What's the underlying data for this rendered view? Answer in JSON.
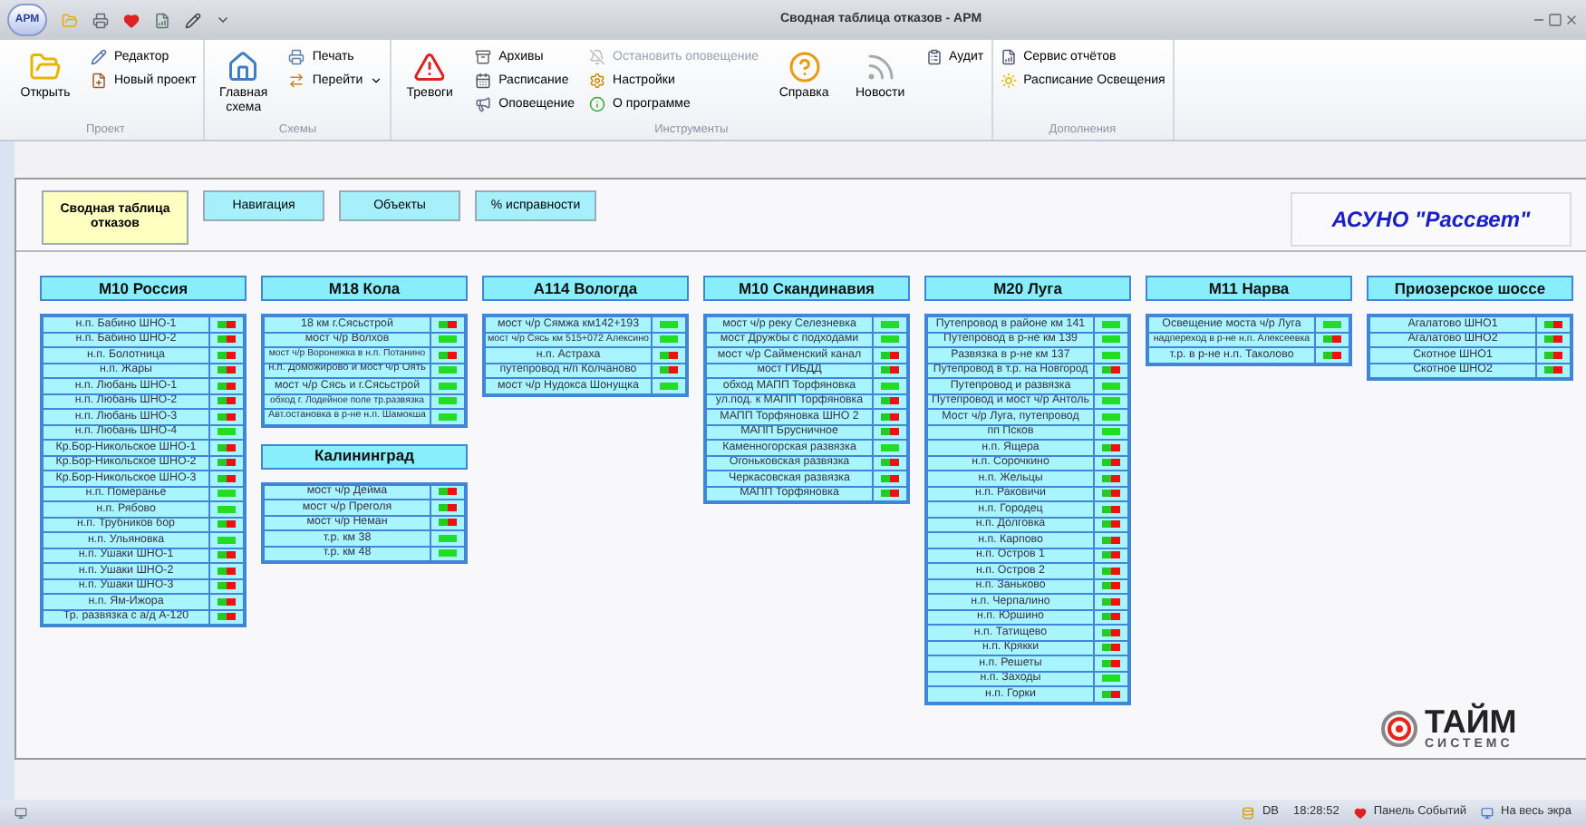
{
  "window": {
    "logo": "АРМ",
    "title": "Сводная таблица отказов - АРМ"
  },
  "ribbon": [
    {
      "label": "Проект",
      "items": [
        {
          "label": "Открыть",
          "kind": "large",
          "disabled": false
        },
        {
          "label": "Редактор",
          "kind": "small",
          "disabled": false
        },
        {
          "label": "Новый проект",
          "kind": "small",
          "disabled": false
        }
      ]
    },
    {
      "label": "Схемы",
      "items": [
        {
          "label": "Главная схема",
          "kind": "large",
          "disabled": false
        },
        {
          "label": "Печать",
          "kind": "small",
          "disabled": false
        },
        {
          "label": "Перейти",
          "kind": "small",
          "disabled": false,
          "caret": true
        }
      ]
    },
    {
      "label": "Инструменты",
      "items": [
        {
          "label": "Тревоги",
          "kind": "large",
          "disabled": false
        },
        {
          "label": "Архивы",
          "kind": "small",
          "disabled": false
        },
        {
          "label": "Расписание",
          "kind": "small",
          "disabled": false
        },
        {
          "label": "Оповещение",
          "kind": "small",
          "disabled": false
        },
        {
          "label": "Остановить оповещение",
          "kind": "small",
          "disabled": true
        },
        {
          "label": "Настройки",
          "kind": "small",
          "disabled": false
        },
        {
          "label": "О программе",
          "kind": "small",
          "disabled": false
        },
        {
          "label": "Справка",
          "kind": "large",
          "disabled": false
        },
        {
          "label": "Новости",
          "kind": "large",
          "disabled": false
        },
        {
          "label": "Аудит",
          "kind": "small",
          "disabled": false
        }
      ]
    },
    {
      "label": "Дополнения",
      "items": [
        {
          "label": "Сервис отчётов",
          "kind": "small",
          "disabled": false
        },
        {
          "label": "Расписание Освещения",
          "kind": "small",
          "disabled": false
        }
      ]
    }
  ],
  "nav": [
    {
      "label": "Сводная таблица отказов",
      "selected": true
    },
    {
      "label": "Навигация",
      "selected": false
    },
    {
      "label": "Объекты",
      "selected": false
    },
    {
      "label": "% исправности",
      "selected": false
    }
  ],
  "brand": "АСУНО \"Рассвет\"",
  "columns": [
    [
      {
        "title": "М10 Россия",
        "rows": [
          {
            "name": "н.п. Бабино ШНО-1",
            "ok": false
          },
          {
            "name": "н.п. Бабино ШНО-2",
            "ok": false
          },
          {
            "name": "н.п. Болотница",
            "ok": false
          },
          {
            "name": "н.п. Жары",
            "ok": false
          },
          {
            "name": "н.п. Любань ШНО-1",
            "ok": false
          },
          {
            "name": "н.п. Любань ШНО-2",
            "ok": false
          },
          {
            "name": "н.п. Любань ШНО-3",
            "ok": false
          },
          {
            "name": "н.п. Любань ШНО-4",
            "ok": true
          },
          {
            "name": "Кр.Бор-Никольское ШНО-1",
            "ok": false
          },
          {
            "name": "Кр.Бор-Никольское ШНО-2",
            "ok": false
          },
          {
            "name": "Кр.Бор-Никольское ШНО-3",
            "ok": false
          },
          {
            "name": "н.п. Померанье",
            "ok": true
          },
          {
            "name": "н.п. Рябово",
            "ok": true
          },
          {
            "name": "н.п. Трубников бор",
            "ok": false
          },
          {
            "name": "н.п. Ульяновка",
            "ok": true
          },
          {
            "name": "н.п. Ушаки ШНО-1",
            "ok": false
          },
          {
            "name": "н.п. Ушаки ШНО-2",
            "ok": false
          },
          {
            "name": "н.п. Ушаки ШНО-3",
            "ok": false
          },
          {
            "name": "н.п. Ям-Ижора",
            "ok": false
          },
          {
            "name": "Тр. развязка с а/д А-120",
            "ok": false
          }
        ]
      }
    ],
    [
      {
        "title": "М18 Кола",
        "rows": [
          {
            "name": "18 км г.Сясьстрой",
            "ok": false
          },
          {
            "name": "мост ч/р Волхов",
            "ok": true
          },
          {
            "name": "мост ч/р Воронежка в н.п. Потанино",
            "ok": false
          },
          {
            "name": "н.п. Доможирово и мост ч/р Оять",
            "ok": true
          },
          {
            "name": "мост ч/р Сясь и г.Сясьстрой",
            "ok": true
          },
          {
            "name": "обход г. Лодейное поле тр.развязка",
            "ok": true
          },
          {
            "name": "Авт.остановка в р-не н.п. Шамокша",
            "ok": true
          }
        ]
      },
      {
        "title": "Калининград",
        "rows": [
          {
            "name": "мост ч/р Дейма",
            "ok": false
          },
          {
            "name": "мост ч/р Преголя",
            "ok": false
          },
          {
            "name": "мост ч/р Неман",
            "ok": false
          },
          {
            "name": "т.р. км 38",
            "ok": true
          },
          {
            "name": "т.р. км 48",
            "ok": true
          }
        ]
      }
    ],
    [
      {
        "title": "А114 Вологда",
        "rows": [
          {
            "name": "мост ч/р Сямжа км142+193",
            "ok": true
          },
          {
            "name": "мост ч/р Сясь км 515+072 Алексино",
            "ok": true
          },
          {
            "name": "н.п. Астраха",
            "ok": false
          },
          {
            "name": "путепровод н/п Колчаново",
            "ok": false
          },
          {
            "name": "мост ч/р Нудокса Шонущка",
            "ok": true
          }
        ]
      }
    ],
    [
      {
        "title": "М10 Скандинавия",
        "rows": [
          {
            "name": "мост ч/р реку Селезневка",
            "ok": true
          },
          {
            "name": "мост Дружбы с подходами",
            "ok": true
          },
          {
            "name": "мост ч/р Сайменский канал",
            "ok": false
          },
          {
            "name": "мост ГИБДД",
            "ok": false
          },
          {
            "name": "обход МАПП Торфяновка",
            "ok": true
          },
          {
            "name": "ул.под. к МАПП Торфяновка",
            "ok": false
          },
          {
            "name": "МАПП Торфяновка ШНО 2",
            "ok": false
          },
          {
            "name": "МАПП Брусничное",
            "ok": false
          },
          {
            "name": "Каменногорская развязка",
            "ok": true
          },
          {
            "name": "Огоньковская развязка",
            "ok": false
          },
          {
            "name": "Черкасовская развязка",
            "ok": false
          },
          {
            "name": "МАПП Торфяновка",
            "ok": false
          }
        ]
      }
    ],
    [
      {
        "title": "М20 Луга",
        "rows": [
          {
            "name": "Путепровод в районе км 141",
            "ok": true
          },
          {
            "name": "Путепровод в р-не км 139",
            "ok": true
          },
          {
            "name": "Развязка в р-не км 137",
            "ok": true
          },
          {
            "name": "Путепровод в т.р. на Новгород",
            "ok": false
          },
          {
            "name": "Путепровод и развязка",
            "ok": true
          },
          {
            "name": "Путепровод и мост ч/р Антоль",
            "ok": true
          },
          {
            "name": "Мост ч/р Луга, путепровод",
            "ok": true
          },
          {
            "name": "пп Псков",
            "ok": true
          },
          {
            "name": "н.п. Ящера",
            "ok": false
          },
          {
            "name": "н.п. Сорочкино",
            "ok": false
          },
          {
            "name": "н.п. Жельцы",
            "ok": false
          },
          {
            "name": "н.п. Раковичи",
            "ok": false
          },
          {
            "name": "н.п. Городец",
            "ok": false
          },
          {
            "name": "н.п. Долговка",
            "ok": false
          },
          {
            "name": "н.п. Карпово",
            "ok": false
          },
          {
            "name": "н.п. Остров 1",
            "ok": false
          },
          {
            "name": "н.п. Остров 2",
            "ok": false
          },
          {
            "name": "н.п. Заньково",
            "ok": false
          },
          {
            "name": "н.п. Черпалино",
            "ok": false
          },
          {
            "name": "н.п. Юршино",
            "ok": false
          },
          {
            "name": "н.п. Татищево",
            "ok": false
          },
          {
            "name": "н.п. Крякки",
            "ok": false
          },
          {
            "name": "н.п. Решеты",
            "ok": false
          },
          {
            "name": "н.п. Заходы",
            "ok": true
          },
          {
            "name": "н.п. Горки",
            "ok": false
          }
        ]
      }
    ],
    [
      {
        "title": "М11 Нарва",
        "rows": [
          {
            "name": "Освещение моста ч/р Луга",
            "ok": true
          },
          {
            "name": "надпереход в р-не н.п. Алексеевка",
            "ok": false
          },
          {
            "name": "т.р. в р-не н.п. Таколово",
            "ok": false
          }
        ]
      }
    ],
    [
      {
        "title": "Приозерское шоссе",
        "rows": [
          {
            "name": "Агалатово ШНО1",
            "ok": false
          },
          {
            "name": "Агалатово ШНО2",
            "ok": false
          },
          {
            "name": "Скотное ШНО1",
            "ok": false
          },
          {
            "name": "Скотное ШНО2",
            "ok": false
          }
        ]
      }
    ]
  ],
  "company": {
    "name": "ТАЙМ",
    "sub": "СИСТЕМС"
  },
  "status": [
    {
      "label": "DB"
    },
    {
      "label": "18:28:52"
    },
    {
      "label": "Панель Событий"
    },
    {
      "label": "На весь экра"
    }
  ]
}
